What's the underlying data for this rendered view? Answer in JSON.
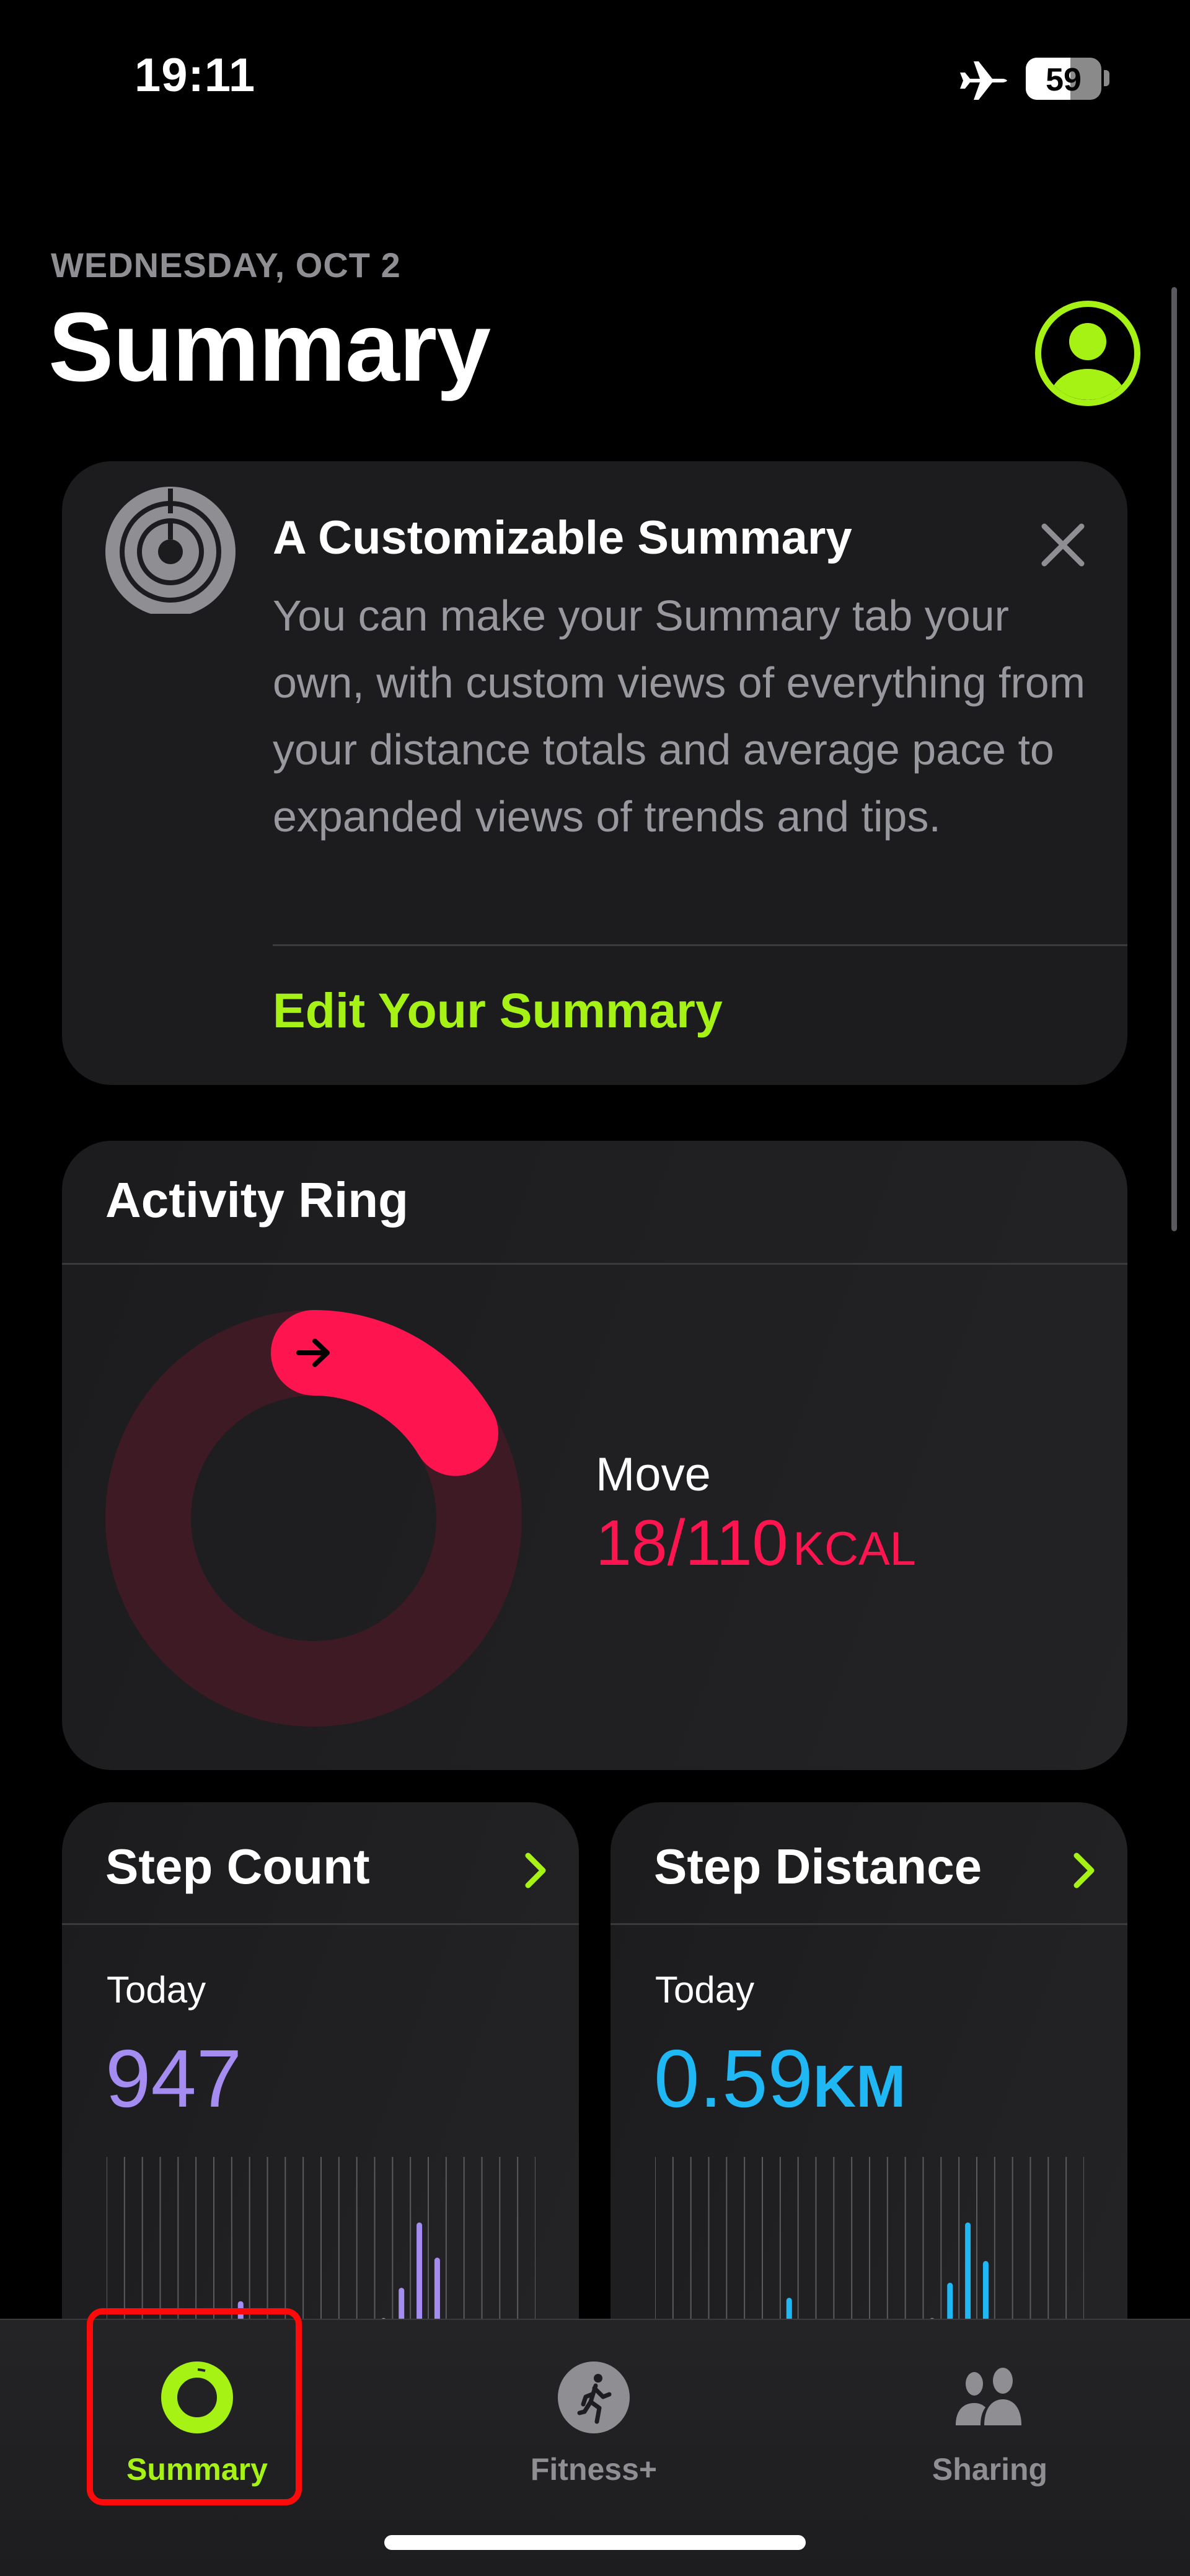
{
  "status_bar": {
    "time": "19:11",
    "airplane_mode": true,
    "battery_percent": "59"
  },
  "header": {
    "date": "WEDNESDAY, OCT 2",
    "title": "Summary",
    "avatar_icon": "person-circle-icon"
  },
  "colors": {
    "accent": "#a6f215",
    "move": "#fe1550",
    "steps": "#a48cf0",
    "distance": "#1fb8f5"
  },
  "tip_card": {
    "title": "A Customizable Summary",
    "body": "You can make your Summary tab your own, with custom views of everything from your distance totals and average pace to expanded views of trends and tips.",
    "action": "Edit Your Summary",
    "icon": "activity-rings-icon",
    "close_icon": "close-icon"
  },
  "activity_ring": {
    "title": "Activity Ring",
    "label": "Move",
    "value": "18/110",
    "unit": "KCAL",
    "progress": 0.164
  },
  "step_count": {
    "title": "Step Count",
    "period": "Today",
    "value": "947",
    "unit": ""
  },
  "step_distance": {
    "title": "Step Distance",
    "period": "Today",
    "value": "0.59",
    "unit": "KM"
  },
  "chart_data": [
    {
      "type": "bar",
      "title": "Step Count",
      "hours": 24,
      "bars": [
        {
          "hour": 7,
          "relative": 0.14
        },
        {
          "hour": 15,
          "relative": 0.04
        },
        {
          "hour": 16,
          "relative": 0.22
        },
        {
          "hour": 17,
          "relative": 0.61
        },
        {
          "hour": 18,
          "relative": 0.4
        }
      ],
      "grid": true
    },
    {
      "type": "bar",
      "title": "Step Distance",
      "hours": 24,
      "bars": [
        {
          "hour": 7,
          "relative": 0.16
        },
        {
          "hour": 15,
          "relative": 0.04
        },
        {
          "hour": 16,
          "relative": 0.25
        },
        {
          "hour": 17,
          "relative": 0.61
        },
        {
          "hour": 18,
          "relative": 0.38
        }
      ],
      "grid": true
    }
  ],
  "tabs": [
    {
      "label": "Summary",
      "icon": "activity-ring-icon",
      "selected": true
    },
    {
      "label": "Fitness+",
      "icon": "running-figure-icon",
      "selected": false
    },
    {
      "label": "Sharing",
      "icon": "people-icon",
      "selected": false
    }
  ]
}
